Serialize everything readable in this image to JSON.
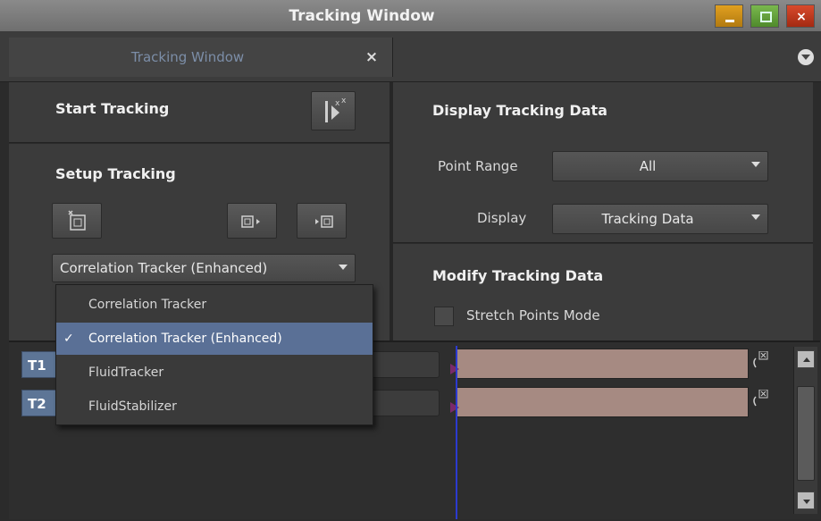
{
  "window": {
    "title": "Tracking Window",
    "buttons": [
      "minimize",
      "maximize",
      "close"
    ],
    "close_glyph": "×"
  },
  "tab": {
    "label": "Tracking Window",
    "close_glyph": "×",
    "menu_icon": "chevron-down-circle-icon"
  },
  "start": {
    "heading": "Start Tracking",
    "icon": "start-tracking-icon"
  },
  "setup": {
    "heading": "Setup Tracking",
    "icons": [
      "new-tracker-icon",
      "track-backward-icon",
      "track-forward-icon"
    ],
    "tracker_select": "Correlation Tracker (Enhanced)"
  },
  "dropdown": {
    "items": [
      {
        "label": "Correlation Tracker",
        "selected": false
      },
      {
        "label": "Correlation Tracker (Enhanced)",
        "selected": true
      },
      {
        "label": "FluidTracker",
        "selected": false
      },
      {
        "label": "FluidStabilizer",
        "selected": false
      }
    ],
    "check": "✓"
  },
  "display": {
    "heading": "Display Tracking Data",
    "point_range_label": "Point Range",
    "point_range_value": "All",
    "display_label": "Display",
    "display_value": "Tracking Data"
  },
  "modify": {
    "heading": "Modify Tracking Data",
    "stretch_label": "Stretch Points Mode",
    "stretch_checked": false
  },
  "tracks": [
    {
      "name": "T1"
    },
    {
      "name": "T2"
    }
  ],
  "colors": {
    "accent": "#5a7096",
    "track_label": "#5d7596",
    "clip": "#a68a82",
    "playhead": "#2b3ad0"
  }
}
